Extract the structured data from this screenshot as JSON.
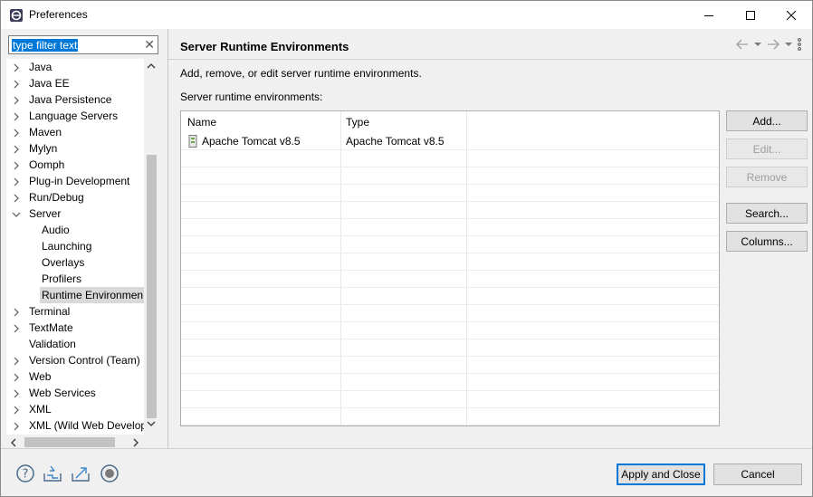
{
  "window": {
    "title": "Preferences"
  },
  "filter": {
    "text": "type filter text"
  },
  "tree": [
    {
      "label": "Java",
      "expandable": true,
      "level": 0
    },
    {
      "label": "Java EE",
      "expandable": true,
      "level": 0
    },
    {
      "label": "Java Persistence",
      "expandable": true,
      "level": 0
    },
    {
      "label": "Language Servers",
      "expandable": true,
      "level": 0
    },
    {
      "label": "Maven",
      "expandable": true,
      "level": 0
    },
    {
      "label": "Mylyn",
      "expandable": true,
      "level": 0
    },
    {
      "label": "Oomph",
      "expandable": true,
      "level": 0
    },
    {
      "label": "Plug-in Development",
      "expandable": true,
      "level": 0
    },
    {
      "label": "Run/Debug",
      "expandable": true,
      "level": 0
    },
    {
      "label": "Server",
      "expandable": true,
      "expanded": true,
      "level": 0
    },
    {
      "label": "Audio",
      "expandable": false,
      "level": 1
    },
    {
      "label": "Launching",
      "expandable": false,
      "level": 1
    },
    {
      "label": "Overlays",
      "expandable": false,
      "level": 1
    },
    {
      "label": "Profilers",
      "expandable": false,
      "level": 1
    },
    {
      "label": "Runtime Environmen",
      "expandable": false,
      "level": 1,
      "selected": true
    },
    {
      "label": "Terminal",
      "expandable": true,
      "level": 0
    },
    {
      "label": "TextMate",
      "expandable": true,
      "level": 0
    },
    {
      "label": "Validation",
      "expandable": false,
      "level": 0
    },
    {
      "label": "Version Control (Team)",
      "expandable": true,
      "level": 0
    },
    {
      "label": "Web",
      "expandable": true,
      "level": 0
    },
    {
      "label": "Web Services",
      "expandable": true,
      "level": 0
    },
    {
      "label": "XML",
      "expandable": true,
      "level": 0
    },
    {
      "label": "XML (Wild Web Develop",
      "expandable": true,
      "level": 0
    }
  ],
  "page": {
    "title": "Server Runtime Environments",
    "description": "Add, remove, or edit server runtime environments.",
    "list_label": "Server runtime environments:",
    "columns": [
      "Name",
      "Type"
    ],
    "rows": [
      {
        "name": "Apache Tomcat v8.5",
        "type": "Apache Tomcat v8.5"
      }
    ]
  },
  "buttons": {
    "add": "Add...",
    "edit": "Edit...",
    "remove": "Remove",
    "search": "Search...",
    "columns": "Columns..."
  },
  "footer": {
    "apply_close": "Apply and Close",
    "cancel": "Cancel"
  }
}
